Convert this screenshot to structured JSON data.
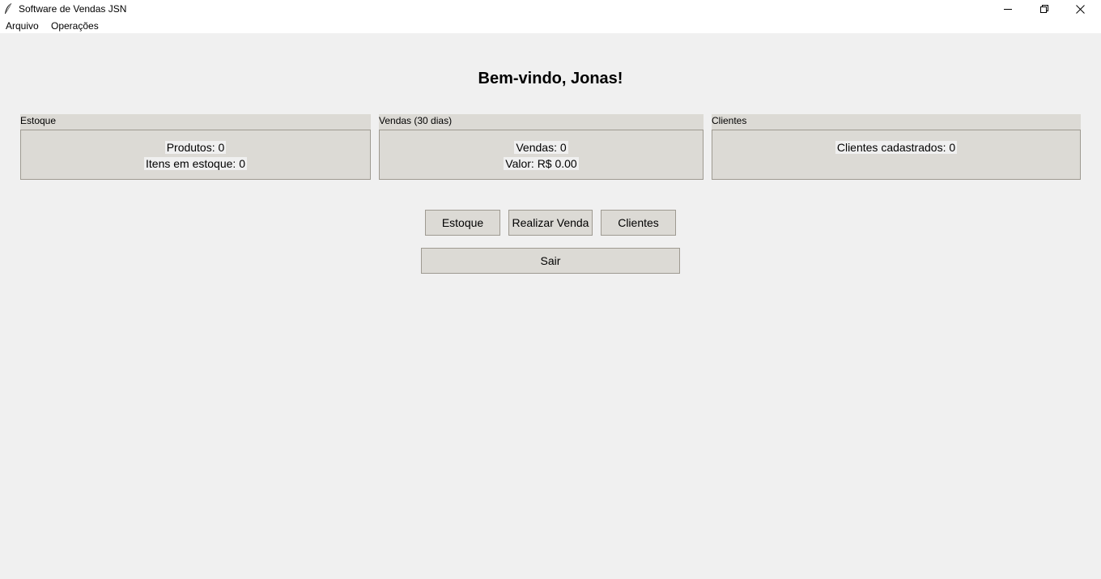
{
  "window": {
    "title": "Software de Vendas JSN",
    "icons": {
      "app": "feather-icon",
      "minimize": "minimize-icon",
      "maximize": "restore-icon",
      "close": "close-icon"
    }
  },
  "menubar": {
    "items": [
      {
        "label": "Arquivo"
      },
      {
        "label": "Operações"
      }
    ]
  },
  "main": {
    "welcome": "Bem-vindo, Jonas!",
    "groups": {
      "estoque": {
        "title": "Estoque",
        "produtos": "Produtos: 0",
        "itens": "Itens em estoque: 0"
      },
      "vendas": {
        "title": "Vendas (30 dias)",
        "vendas": "Vendas: 0",
        "valor": "Valor: R$ 0.00"
      },
      "clientes": {
        "title": "Clientes",
        "cadastrados": "Clientes cadastrados: 0"
      }
    },
    "buttons": {
      "estoque": "Estoque",
      "realizar_venda": "Realizar Venda",
      "clientes": "Clientes",
      "sair": "Sair"
    }
  },
  "colors": {
    "background": "#f0f0f0",
    "titlebar": "#ffffff",
    "widget": "#dcdad5",
    "border": "#9e9a91"
  }
}
